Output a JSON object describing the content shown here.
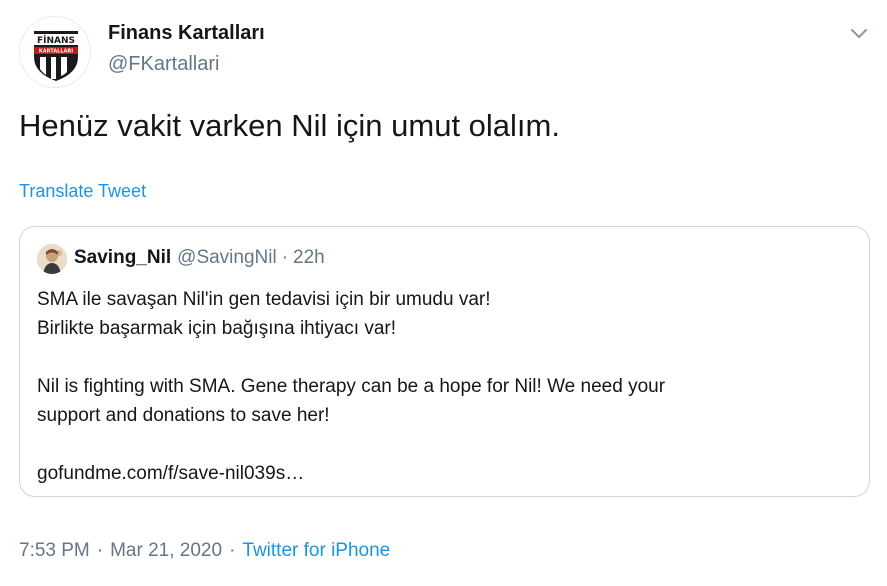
{
  "author": {
    "display_name": "Finans Kartalları",
    "handle": "@FKartallari",
    "avatar_icon": "finans-kartallari-logo",
    "logo_text_top": "FİNANS",
    "logo_text_bottom": "KARTALLARI"
  },
  "menu": {
    "icon": "chevron-down-icon"
  },
  "tweet": {
    "text": "Henüz vakit varken Nil için umut olalım.",
    "translate_label": "Translate Tweet"
  },
  "quoted": {
    "display_name": "Saving_Nil",
    "handle": "@SavingNil",
    "separator": "·",
    "time": "22h",
    "lines": [
      "SMA ile savaşan Nil'in gen tedavisi için bir umudu var!",
      "Birlikte başarmak için bağışına ihtiyacı var!",
      "",
      "Nil is fighting with SMA. Gene therapy can be a hope for Nil! We need your",
      "support and donations to save her!",
      "",
      "gofundme.com/f/save-nil039s…"
    ]
  },
  "footer": {
    "time": "7:53 PM",
    "date": "Mar 21, 2020",
    "separator": "·",
    "source": "Twitter for iPhone"
  },
  "colors": {
    "link": "#1b95e0",
    "muted": "#657786",
    "text": "#14171a",
    "border": "#ccd6dd"
  }
}
